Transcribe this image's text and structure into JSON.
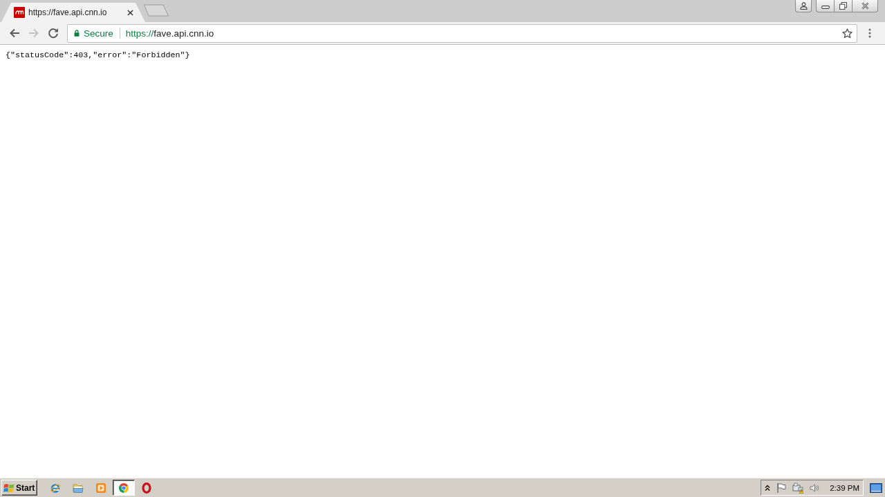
{
  "browser": {
    "tabs": [
      {
        "title": "https://fave.api.cnn.io",
        "selected": true
      }
    ]
  },
  "toolbar": {
    "nav": [
      {
        "kind": "back",
        "disabled": false
      },
      {
        "kind": "forward",
        "disabled": true
      },
      {
        "kind": "reload",
        "disabled": false
      }
    ],
    "address_bar": {
      "security_label": "Secure",
      "url_scheme": "https://",
      "url_host": "fave.api.cnn.io"
    }
  },
  "page": {
    "body_text": "{\"statusCode\":403,\"error\":\"Forbidden\"}"
  },
  "taskbar": {
    "start_label": "Start",
    "apps": [
      {
        "kind": "globe",
        "selected": false
      },
      {
        "kind": "folder",
        "selected": false
      },
      {
        "kind": "play",
        "selected": false
      },
      {
        "kind": "wheel",
        "selected": true
      },
      {
        "kind": "ring",
        "selected": false
      }
    ],
    "clock": "2:39 PM"
  }
}
